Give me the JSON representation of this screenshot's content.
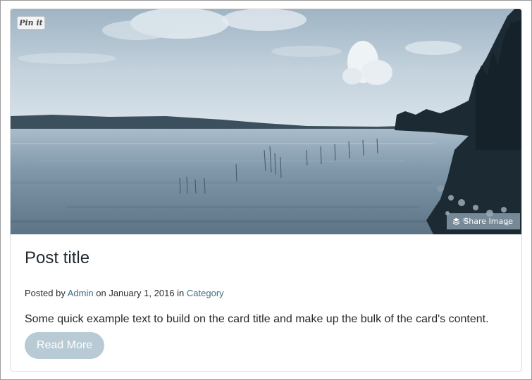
{
  "card": {
    "pin_button_label": "Pin it",
    "share_button_label": "Share Image",
    "title": "Post title",
    "meta": {
      "prefix": "Posted by",
      "author": "Admin",
      "date_prefix": "on",
      "date": "January 1, 2016",
      "category_prefix": "in",
      "category": "Category"
    },
    "excerpt": "Some quick example text to build on the card title and make up the bulk of the card's content.",
    "read_more_label": "Read More"
  },
  "colors": {
    "link": "#3f6c84",
    "button": "#b8cad4",
    "title": "#222a30"
  }
}
